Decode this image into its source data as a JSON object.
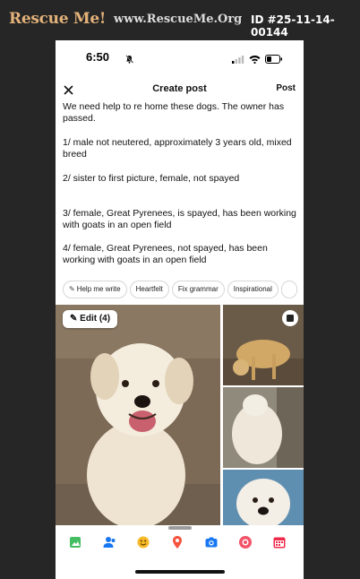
{
  "banner": {
    "logo": "Rescue Me!",
    "site": "www.RescueMe.Org",
    "id": "ID #25-11-14-00144"
  },
  "status_bar": {
    "time": "6:50"
  },
  "header": {
    "title": "Create post",
    "post_label": "Post"
  },
  "post": {
    "p1": "We need help to re home these dogs. The owner has passed.",
    "p2": "1/ male not neutered, approximately 3 years old, mixed breed",
    "p3": "2/ sister to first picture, female, not spayed",
    "p4": "3/ female, Great Pyrenees, is spayed, has been working with goats in an open field",
    "p5": "4/ female, Great Pyrenees, not spayed, has been working with goats in an open field"
  },
  "chips": [
    "Help me write",
    "Heartfelt",
    "Fix grammar",
    "Inspirational"
  ],
  "photos": {
    "edit_label": "Edit (4)"
  },
  "toolbar": {
    "icons": [
      "photo-icon",
      "tag-people-icon",
      "feeling-icon",
      "location-icon",
      "camera-icon",
      "gif-icon",
      "event-icon"
    ]
  },
  "colors": {
    "logo": "#e3b27a",
    "background": "#262626",
    "panel": "#ffffff"
  }
}
